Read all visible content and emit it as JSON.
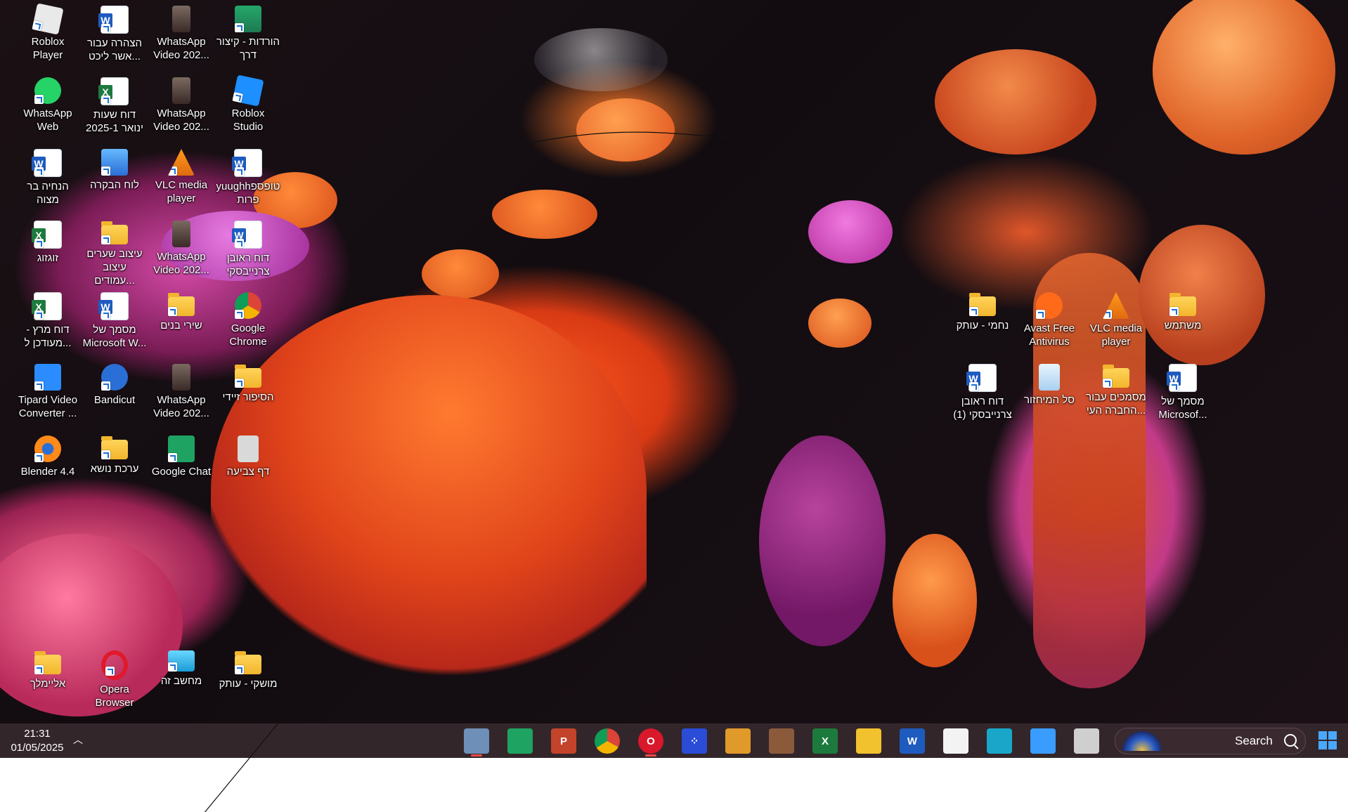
{
  "desktop": {
    "left_icons": [
      {
        "label": "Roblox Player",
        "icon": "roblox-icon",
        "kind": "roblox"
      },
      {
        "label": "הצהרה עבור אשר ליכט...",
        "icon": "word-document-icon",
        "kind": "word"
      },
      {
        "label": "WhatsApp Video 202...",
        "icon": "video-thumbnail-icon",
        "kind": "thumb"
      },
      {
        "label": "הורדות - קיצור דרך",
        "icon": "downloads-folder-icon",
        "kind": "downloads"
      },
      {
        "label": "WhatsApp Web",
        "icon": "whatsapp-icon",
        "kind": "whatsapp"
      },
      {
        "label": "דוח שעות ינואר 2025-1",
        "icon": "excel-document-icon",
        "kind": "excel"
      },
      {
        "label": "WhatsApp Video 202...",
        "icon": "video-thumbnail-icon",
        "kind": "thumb"
      },
      {
        "label": "Roblox Studio",
        "icon": "roblox-studio-icon",
        "kind": "studio"
      },
      {
        "label": "הנחיה בר מצוה",
        "icon": "word-document-icon",
        "kind": "word"
      },
      {
        "label": "לוח הבקרה",
        "icon": "control-panel-icon",
        "kind": "control"
      },
      {
        "label": "VLC media player",
        "icon": "vlc-icon",
        "kind": "vlc"
      },
      {
        "label": "yuughhטופספ פרות",
        "icon": "word-document-icon",
        "kind": "word"
      },
      {
        "label": "זוגזוג",
        "icon": "excel-document-icon",
        "kind": "excel"
      },
      {
        "label": "עיצוב שערים עיצוב עמודים...",
        "icon": "folder-icon",
        "kind": "folder"
      },
      {
        "label": "WhatsApp Video 202...",
        "icon": "video-thumbnail-icon",
        "kind": "thumb"
      },
      {
        "label": "דוח ראובן צרנייבסקי",
        "icon": "word-document-icon",
        "kind": "word"
      },
      {
        "label": "דוח מרץ - מעודכן ל...",
        "icon": "excel-document-icon",
        "kind": "excel"
      },
      {
        "label": "מסמך של Microsoft W...",
        "icon": "word-document-icon",
        "kind": "word"
      },
      {
        "label": "שירי בנים",
        "icon": "folder-icon",
        "kind": "folder"
      },
      {
        "label": "Google Chrome",
        "icon": "chrome-icon",
        "kind": "chrome"
      },
      {
        "label": "Tipard Video Converter ...",
        "icon": "tipard-icon",
        "kind": "tipard"
      },
      {
        "label": "Bandicut",
        "icon": "bandicut-icon",
        "kind": "bandicut"
      },
      {
        "label": "WhatsApp Video 202...",
        "icon": "video-thumbnail-icon",
        "kind": "thumb"
      },
      {
        "label": "הסיפור זיידי",
        "icon": "folder-icon",
        "kind": "folder"
      },
      {
        "label": "Blender 4.4",
        "icon": "blender-icon",
        "kind": "blender"
      },
      {
        "label": "ערכת נושא",
        "icon": "folder-icon",
        "kind": "folder"
      },
      {
        "label": "Google Chat",
        "icon": "google-chat-icon",
        "kind": "gchat"
      },
      {
        "label": "דף צביעה",
        "icon": "image-file-icon",
        "kind": "image"
      }
    ],
    "bottom_icons": [
      {
        "label": "אליימלך",
        "icon": "folder-icon",
        "kind": "folder"
      },
      {
        "label": "Opera Browser",
        "icon": "opera-icon",
        "kind": "opera"
      },
      {
        "label": "מחשב זה",
        "icon": "this-pc-icon",
        "kind": "pc"
      },
      {
        "label": "מושקי - עותק",
        "icon": "folder-icon",
        "kind": "folder"
      }
    ],
    "right_icons": [
      {
        "label": "נחמי - עותק",
        "icon": "folder-icon",
        "kind": "folder"
      },
      {
        "label": "Avast Free Antivirus",
        "icon": "avast-icon",
        "kind": "avast"
      },
      {
        "label": "VLC media player",
        "icon": "vlc-icon",
        "kind": "vlc"
      },
      {
        "label": "משתמש",
        "icon": "user-folder-icon",
        "kind": "folder"
      },
      {
        "label": "דוח ראובן צרנייבסקי (1)",
        "icon": "word-document-icon",
        "kind": "word"
      },
      {
        "label": "סל המיחזור",
        "icon": "recycle-bin-icon",
        "kind": "recycle"
      },
      {
        "label": "מסמכים עבור החברה העי...",
        "icon": "folder-icon",
        "kind": "folder"
      },
      {
        "label": "מסמך של Microsof...",
        "icon": "word-document-icon",
        "kind": "word"
      }
    ]
  },
  "taskbar": {
    "time": "21:31",
    "date": "01/05/2025",
    "tray_chevron_icon": "chevron-up-icon",
    "apps": [
      {
        "name": "gear-app-icon",
        "glyph": "",
        "color": "#6e8fb8",
        "active": true
      },
      {
        "name": "google-chat-icon",
        "glyph": "",
        "color": "#1ea362",
        "active": false
      },
      {
        "name": "powerpoint-icon",
        "glyph": "P",
        "color": "#c4432b",
        "active": false
      },
      {
        "name": "chrome-icon",
        "glyph": "",
        "color": "#e0a82e",
        "active": false
      },
      {
        "name": "opera-icon",
        "glyph": "O",
        "color": "#d9182b",
        "active": true
      },
      {
        "name": "dice-app-icon",
        "glyph": "⁘",
        "color": "#2a4cd6",
        "active": false
      },
      {
        "name": "calendar-app-icon",
        "glyph": "",
        "color": "#e09a2a",
        "active": false
      },
      {
        "name": "photo-app-icon",
        "glyph": "",
        "color": "#8a5a3a",
        "active": false
      },
      {
        "name": "excel-icon",
        "glyph": "X",
        "color": "#1d7a3e",
        "active": false
      },
      {
        "name": "file-explorer-icon",
        "glyph": "",
        "color": "#f2c12e",
        "active": false
      },
      {
        "name": "word-icon",
        "glyph": "W",
        "color": "#1e5bbf",
        "active": false
      },
      {
        "name": "microsoft-store-icon",
        "glyph": "",
        "color": "#f3f3f3",
        "active": false
      },
      {
        "name": "edge-icon",
        "glyph": "",
        "color": "#1aa6c9",
        "active": false
      },
      {
        "name": "widgets-icon",
        "glyph": "",
        "color": "#3a9cff",
        "active": false
      },
      {
        "name": "task-view-icon",
        "glyph": "",
        "color": "#cfcfcf",
        "active": false
      }
    ],
    "search_placeholder": "Search"
  }
}
